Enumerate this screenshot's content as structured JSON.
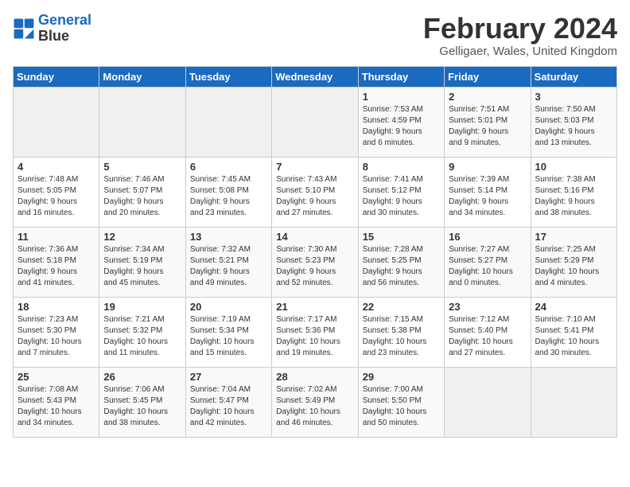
{
  "header": {
    "logo_line1": "General",
    "logo_line2": "Blue",
    "month_year": "February 2024",
    "location": "Gelligaer, Wales, United Kingdom"
  },
  "weekdays": [
    "Sunday",
    "Monday",
    "Tuesday",
    "Wednesday",
    "Thursday",
    "Friday",
    "Saturday"
  ],
  "weeks": [
    [
      {
        "day": "",
        "info": ""
      },
      {
        "day": "",
        "info": ""
      },
      {
        "day": "",
        "info": ""
      },
      {
        "day": "",
        "info": ""
      },
      {
        "day": "1",
        "info": "Sunrise: 7:53 AM\nSunset: 4:59 PM\nDaylight: 9 hours\nand 6 minutes."
      },
      {
        "day": "2",
        "info": "Sunrise: 7:51 AM\nSunset: 5:01 PM\nDaylight: 9 hours\nand 9 minutes."
      },
      {
        "day": "3",
        "info": "Sunrise: 7:50 AM\nSunset: 5:03 PM\nDaylight: 9 hours\nand 13 minutes."
      }
    ],
    [
      {
        "day": "4",
        "info": "Sunrise: 7:48 AM\nSunset: 5:05 PM\nDaylight: 9 hours\nand 16 minutes."
      },
      {
        "day": "5",
        "info": "Sunrise: 7:46 AM\nSunset: 5:07 PM\nDaylight: 9 hours\nand 20 minutes."
      },
      {
        "day": "6",
        "info": "Sunrise: 7:45 AM\nSunset: 5:08 PM\nDaylight: 9 hours\nand 23 minutes."
      },
      {
        "day": "7",
        "info": "Sunrise: 7:43 AM\nSunset: 5:10 PM\nDaylight: 9 hours\nand 27 minutes."
      },
      {
        "day": "8",
        "info": "Sunrise: 7:41 AM\nSunset: 5:12 PM\nDaylight: 9 hours\nand 30 minutes."
      },
      {
        "day": "9",
        "info": "Sunrise: 7:39 AM\nSunset: 5:14 PM\nDaylight: 9 hours\nand 34 minutes."
      },
      {
        "day": "10",
        "info": "Sunrise: 7:38 AM\nSunset: 5:16 PM\nDaylight: 9 hours\nand 38 minutes."
      }
    ],
    [
      {
        "day": "11",
        "info": "Sunrise: 7:36 AM\nSunset: 5:18 PM\nDaylight: 9 hours\nand 41 minutes."
      },
      {
        "day": "12",
        "info": "Sunrise: 7:34 AM\nSunset: 5:19 PM\nDaylight: 9 hours\nand 45 minutes."
      },
      {
        "day": "13",
        "info": "Sunrise: 7:32 AM\nSunset: 5:21 PM\nDaylight: 9 hours\nand 49 minutes."
      },
      {
        "day": "14",
        "info": "Sunrise: 7:30 AM\nSunset: 5:23 PM\nDaylight: 9 hours\nand 52 minutes."
      },
      {
        "day": "15",
        "info": "Sunrise: 7:28 AM\nSunset: 5:25 PM\nDaylight: 9 hours\nand 56 minutes."
      },
      {
        "day": "16",
        "info": "Sunrise: 7:27 AM\nSunset: 5:27 PM\nDaylight: 10 hours\nand 0 minutes."
      },
      {
        "day": "17",
        "info": "Sunrise: 7:25 AM\nSunset: 5:29 PM\nDaylight: 10 hours\nand 4 minutes."
      }
    ],
    [
      {
        "day": "18",
        "info": "Sunrise: 7:23 AM\nSunset: 5:30 PM\nDaylight: 10 hours\nand 7 minutes."
      },
      {
        "day": "19",
        "info": "Sunrise: 7:21 AM\nSunset: 5:32 PM\nDaylight: 10 hours\nand 11 minutes."
      },
      {
        "day": "20",
        "info": "Sunrise: 7:19 AM\nSunset: 5:34 PM\nDaylight: 10 hours\nand 15 minutes."
      },
      {
        "day": "21",
        "info": "Sunrise: 7:17 AM\nSunset: 5:36 PM\nDaylight: 10 hours\nand 19 minutes."
      },
      {
        "day": "22",
        "info": "Sunrise: 7:15 AM\nSunset: 5:38 PM\nDaylight: 10 hours\nand 23 minutes."
      },
      {
        "day": "23",
        "info": "Sunrise: 7:12 AM\nSunset: 5:40 PM\nDaylight: 10 hours\nand 27 minutes."
      },
      {
        "day": "24",
        "info": "Sunrise: 7:10 AM\nSunset: 5:41 PM\nDaylight: 10 hours\nand 30 minutes."
      }
    ],
    [
      {
        "day": "25",
        "info": "Sunrise: 7:08 AM\nSunset: 5:43 PM\nDaylight: 10 hours\nand 34 minutes."
      },
      {
        "day": "26",
        "info": "Sunrise: 7:06 AM\nSunset: 5:45 PM\nDaylight: 10 hours\nand 38 minutes."
      },
      {
        "day": "27",
        "info": "Sunrise: 7:04 AM\nSunset: 5:47 PM\nDaylight: 10 hours\nand 42 minutes."
      },
      {
        "day": "28",
        "info": "Sunrise: 7:02 AM\nSunset: 5:49 PM\nDaylight: 10 hours\nand 46 minutes."
      },
      {
        "day": "29",
        "info": "Sunrise: 7:00 AM\nSunset: 5:50 PM\nDaylight: 10 hours\nand 50 minutes."
      },
      {
        "day": "",
        "info": ""
      },
      {
        "day": "",
        "info": ""
      }
    ]
  ]
}
